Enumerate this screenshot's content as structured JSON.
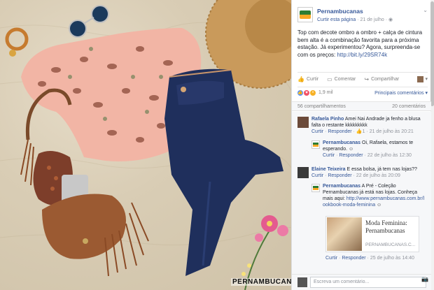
{
  "post": {
    "page_name": "Pernambucanas",
    "like_page": "Curtir esta página",
    "date": "· 21 de julho ·",
    "text": "Top com decote ombro a ombro + calça de cintura bem alta é a combinação favorita para a próxima estação. Já experimentou? Agora, surpreenda-se com os preços: ",
    "link": "http://bit.ly/29SR74k",
    "photo_brand": "PERNAMBUCANAS"
  },
  "actions": {
    "like": "Curtir",
    "comment": "Comentar",
    "share": "Compartilhar",
    "dropdown": "▾"
  },
  "reactions": {
    "count": "1,9 mil",
    "sort": "Principais comentários ▾"
  },
  "stats": {
    "shares": "56 compartilhamentos",
    "comments": "20 comentários"
  },
  "comments": [
    {
      "author": "Rafaela Pinho",
      "text": " Amei Nai Andrade ja fenho a blusa falta o restante kkkkkkkkk",
      "like": "Curtir",
      "reply": "Responder",
      "likes": "1",
      "time": "21 de julho às 20:21"
    },
    {
      "author": "Pernambucanas",
      "text": " Oi, Rafaela, estamos te esperando. ☺",
      "like": "Curtir",
      "reply": "Responder",
      "time": "22 de julho às 12:30"
    },
    {
      "author": "Elaine Teixeira",
      "text": " E essa bolsa, já tem nas lojas??",
      "like": "Curtir",
      "reply": "Responder",
      "time": "22 de julho às 20:09"
    },
    {
      "author": "Pernambucanas",
      "text": " A Pré - Coleção Pernambucanas já está nas lojas. Conheça mais aqui:",
      "link": "http://www.pernambucanas.com.br/lookbook-moda-feminina",
      "emoji": " ☺",
      "like": "Curtir",
      "reply": "Responder",
      "time": "25 de julho às 14:40"
    }
  ],
  "link_card": {
    "title": "Moda Feminina: Pernambucanas",
    "domain": "PERNAMBUCANAS.C..."
  },
  "reply_box": {
    "placeholder": "Escreva um comentário..."
  }
}
